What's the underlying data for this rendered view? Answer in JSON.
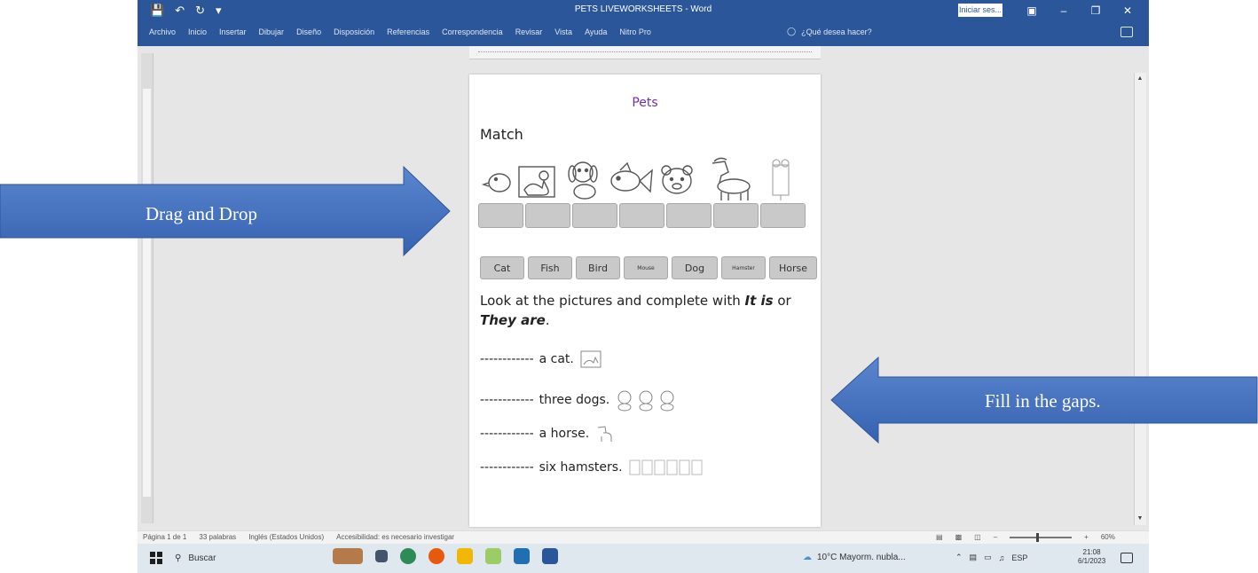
{
  "window": {
    "title": "PETS LIVEWORKSHEETS  -  Word",
    "signin_label": "Iniciar ses...",
    "qat": [
      "save-icon",
      "undo-icon",
      "redo-icon",
      "customize-icon"
    ]
  },
  "ribbon": {
    "tabs": [
      "Archivo",
      "Inicio",
      "Insertar",
      "Dibujar",
      "Diseño",
      "Disposición",
      "Referencias",
      "Correspondencia",
      "Revisar",
      "Vista",
      "Ayuda",
      "Nitro Pro"
    ],
    "tell_me": "¿Qué desea hacer?"
  },
  "document": {
    "title": "Pets",
    "match_heading": "Match",
    "word_bank": [
      "Cat",
      "Fish",
      "Bird",
      "Mouse",
      "Dog",
      "Hamster",
      "Horse"
    ],
    "instruction": {
      "part1": "Look at the pictures and complete with ",
      "it_is": "It is",
      "part2": " or ",
      "they_are": "They are",
      "part3": "."
    },
    "sentences": [
      {
        "blank": "------------",
        "text": "a cat."
      },
      {
        "blank": "------------",
        "text": "three dogs."
      },
      {
        "blank": "------------",
        "text": "a horse."
      },
      {
        "blank": "------------",
        "text": "six hamsters."
      }
    ]
  },
  "statusbar": {
    "page": "Página 1 de 1",
    "words": "33 palabras",
    "language": "Inglés (Estados Unidos)",
    "accessibility": "Accesibilidad: es necesario investigar",
    "zoom": "60%"
  },
  "taskbar": {
    "search_placeholder": "Buscar",
    "weather": "10°C  Mayorm. nubla...",
    "lang": "ESP",
    "time": "21:08",
    "date": "6/1/2023"
  },
  "callouts": {
    "left": "Drag and Drop",
    "right": "Fill in the gaps."
  },
  "colors": {
    "word_blue": "#2b579a",
    "title_purple": "#7030a0",
    "arrow_blue": "#4472c4"
  }
}
